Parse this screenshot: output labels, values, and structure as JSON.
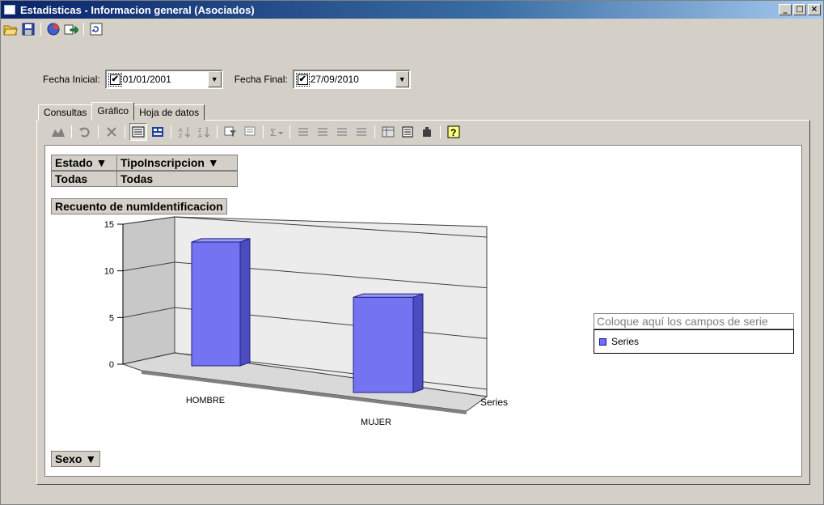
{
  "window": {
    "title": "Estadisticas - Informacion general (Asociados)",
    "caption_min": "_",
    "caption_max": "□",
    "caption_close": "×"
  },
  "toolbar": {
    "icons": [
      "open-folder-icon",
      "save-icon",
      "chart-pie-icon",
      "export-icon",
      "refresh-icon"
    ]
  },
  "dates": {
    "start_label": "Fecha Inicial:",
    "start_value": "01/01/2001",
    "end_label": "Fecha Final:",
    "end_value": "27/09/2010",
    "checkbox_mark": "✔",
    "dropdown_glyph": "▼"
  },
  "tabs": [
    {
      "label": "Consultas",
      "active": false
    },
    {
      "label": "Gráfico",
      "active": true
    },
    {
      "label": "Hoja de datos",
      "active": false
    }
  ],
  "pivot": {
    "filter_fields": [
      {
        "name": "Estado ▼",
        "value": "Todas"
      },
      {
        "name": "TipoInscripcion ▼",
        "value": "Todas"
      }
    ],
    "data_field": "Recuento de numIdentificacion",
    "category_field": "Sexo ▼",
    "series_drop_text": "Coloque aquí los campos de serie",
    "legend_series": "Series"
  },
  "chart_data": {
    "type": "bar",
    "categories": [
      "HOMBRE",
      "MUJER"
    ],
    "series": [
      {
        "name": "Series",
        "values": [
          13,
          10
        ]
      }
    ],
    "ylim": [
      0,
      15
    ],
    "yticks": [
      "0",
      "5",
      "10",
      "15"
    ],
    "z_label": "Series",
    "color": "#7474f2"
  }
}
